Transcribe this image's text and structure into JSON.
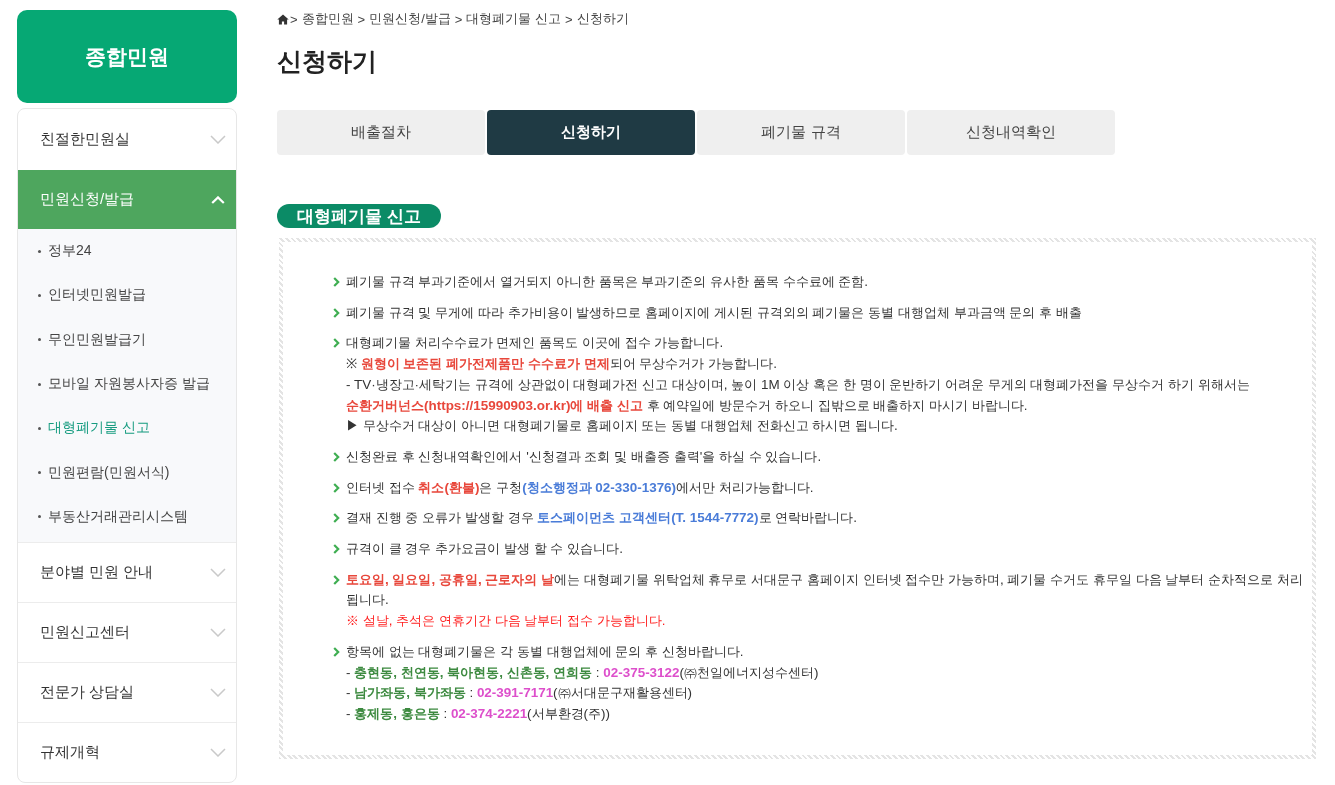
{
  "sidebar": {
    "title": "종합민원",
    "menu": [
      {
        "label": "친절한민원실",
        "expanded": false
      },
      {
        "label": "민원신청/발급",
        "expanded": true,
        "children": [
          {
            "label": "정부24",
            "selected": false
          },
          {
            "label": "인터넷민원발급",
            "selected": false
          },
          {
            "label": "무인민원발급기",
            "selected": false
          },
          {
            "label": "모바일 자원봉사자증 발급",
            "selected": false
          },
          {
            "label": "대형폐기물 신고",
            "selected": true
          },
          {
            "label": "민원편람(민원서식)",
            "selected": false
          },
          {
            "label": "부동산거래관리시스템",
            "selected": false
          }
        ]
      },
      {
        "label": "분야별 민원 안내",
        "expanded": false
      },
      {
        "label": "민원신고센터",
        "expanded": false
      },
      {
        "label": "전문가 상담실",
        "expanded": false
      },
      {
        "label": "규제개혁",
        "expanded": false
      }
    ]
  },
  "breadcrumb": {
    "separator": ">",
    "items": [
      "종합민원",
      "민원신청/발급",
      "대형폐기물 신고",
      "신청하기"
    ]
  },
  "page_title": "신청하기",
  "tabs": [
    {
      "label": "배출절차",
      "selected": false
    },
    {
      "label": "신청하기",
      "selected": true
    },
    {
      "label": "폐기물 규격",
      "selected": false
    },
    {
      "label": "신청내역확인",
      "selected": false
    }
  ],
  "section": {
    "heading": "대형폐기물 신고",
    "notices": [
      {
        "lines": [
          [
            {
              "text": "폐기물 규격 부과기준에서 열거되지 아니한 품목은 부과기준의 유사한 품목 수수료에 준함.",
              "kind": "plain"
            }
          ]
        ]
      },
      {
        "lines": [
          [
            {
              "text": "폐기물 규격 및 무게에 따라 추가비용이 발생하므로 홈페이지에 게시된 규격외의 폐기물은 동별 대행업체 부과금액 문의 후 배출",
              "kind": "plain"
            }
          ]
        ]
      },
      {
        "lines": [
          [
            {
              "text": "대형폐기물 처리수수료가 면제인 품목도 이곳에 접수 가능합니다.",
              "kind": "plain"
            }
          ],
          [
            {
              "text": "※ ",
              "kind": "plain"
            },
            {
              "text": "원형이 보존된 폐가전제품만 수수료가 면제",
              "kind": "alert"
            },
            {
              "text": "되어 무상수거가 가능합니다.",
              "kind": "plain"
            }
          ],
          [
            {
              "text": "- TV·냉장고·세탁기는 규격에 상관없이 대형폐가전 신고 대상이며, 높이 1M 이상 혹은 한 명이 운반하기 어려운 무게의 대형폐가전을 무상수거 하기 위해서는 ",
              "kind": "plain"
            },
            {
              "text": "순환거버넌스(https://15990903.or.kr)에 배출 신고",
              "kind": "alert"
            },
            {
              "text": " 후 예약일에 방문수거 하오니 집밖으로 배출하지 마시기 바랍니다.",
              "kind": "plain"
            }
          ],
          [
            {
              "text": "▶ 무상수거 대상이 아니면 대형폐기물로 홈페이지 또는 동별 대행업체 전화신고 하시면 됩니다.",
              "kind": "plain"
            }
          ]
        ]
      },
      {
        "lines": [
          [
            {
              "text": "신청완료 후 신청내역확인에서 '신청결과 조회 및 배출증 출력'을 하실 수 있습니다.",
              "kind": "plain"
            }
          ]
        ]
      },
      {
        "lines": [
          [
            {
              "text": "인터넷 접수 ",
              "kind": "plain"
            },
            {
              "text": "취소(환불)",
              "kind": "alert"
            },
            {
              "text": "은 구청",
              "kind": "plain"
            },
            {
              "text": "(청소행정과 02-330-1376)",
              "kind": "contact"
            },
            {
              "text": "에서만 처리가능합니다.",
              "kind": "plain"
            }
          ]
        ]
      },
      {
        "lines": [
          [
            {
              "text": "결재 진행 중 오류가 발생할 경우 ",
              "kind": "plain"
            },
            {
              "text": "토스페이먼츠 고객센터(T. 1544-7772)",
              "kind": "contact"
            },
            {
              "text": "로 연락바랍니다.",
              "kind": "plain"
            }
          ]
        ]
      },
      {
        "lines": [
          [
            {
              "text": "규격이 클 경우 추가요금이 발생 할 수 있습니다.",
              "kind": "plain"
            }
          ]
        ]
      },
      {
        "lines": [
          [
            {
              "text": "토요일, 일요일, 공휴일, 근로자의 날",
              "kind": "alert"
            },
            {
              "text": "에는 대형폐기물 위탁업체 휴무로 서대문구 홈페이지 인터넷 접수만 가능하며, 폐기물 수거도 휴무일 다음 날부터 순차적으로 처리됩니다.",
              "kind": "plain"
            }
          ],
          [
            {
              "text": "※ 설날, 추석은 연휴기간 다음 날부터 접수 가능합니다.",
              "kind": "notice"
            }
          ]
        ]
      },
      {
        "lines": [
          [
            {
              "text": "항목에 없는 대형폐기물은 각 동별 대행업체에 문의 후 신청바랍니다.",
              "kind": "plain"
            }
          ],
          [
            {
              "text": "- ",
              "kind": "plain"
            },
            {
              "text": "충현동, 천연동, 북아현동, 신촌동, 연희동",
              "kind": "area"
            },
            {
              "text": " : ",
              "kind": "plain"
            },
            {
              "text": "02-375-3122",
              "kind": "phone"
            },
            {
              "text": "(㈜천일에너지성수센터)",
              "kind": "plain"
            }
          ],
          [
            {
              "text": "- ",
              "kind": "plain"
            },
            {
              "text": "남가좌동, 북가좌동",
              "kind": "area"
            },
            {
              "text": " : ",
              "kind": "plain"
            },
            {
              "text": "02-391-7171",
              "kind": "phone"
            },
            {
              "text": "(㈜서대문구재활용센터)",
              "kind": "plain"
            }
          ],
          [
            {
              "text": "- ",
              "kind": "plain"
            },
            {
              "text": "홍제동, 홍은동",
              "kind": "area"
            },
            {
              "text": " : ",
              "kind": "plain"
            },
            {
              "text": "02-374-2221",
              "kind": "phone"
            },
            {
              "text": "(서부환경(주))",
              "kind": "plain"
            }
          ]
        ]
      }
    ]
  }
}
